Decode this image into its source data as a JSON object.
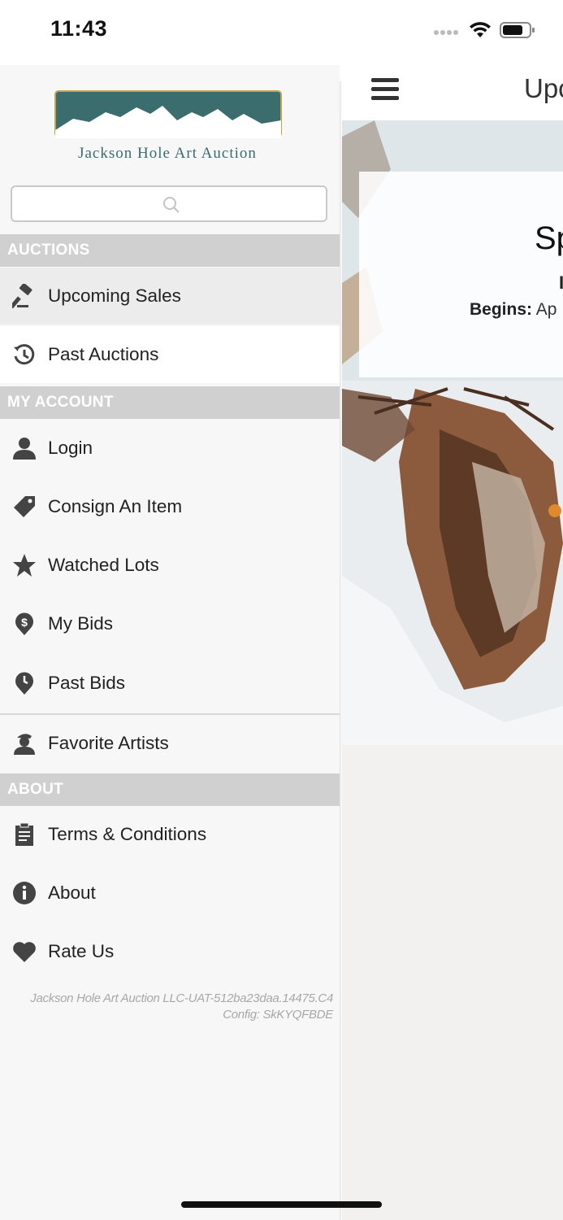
{
  "status": {
    "time": "11:43"
  },
  "brand": {
    "logo_text": "Jackson Hole Art Auction",
    "colors": {
      "teal": "#3b6c6e",
      "gold": "#c8a24e"
    }
  },
  "search": {
    "placeholder": ""
  },
  "sections": {
    "auctions": "AUCTIONS",
    "my_account": "MY ACCOUNT",
    "about": "ABOUT"
  },
  "menu": {
    "upcoming_sales": {
      "label": "Upcoming Sales",
      "icon": "gavel-icon"
    },
    "past_auctions": {
      "label": "Past Auctions",
      "icon": "history-icon"
    },
    "login": {
      "label": "Login",
      "icon": "user-icon"
    },
    "consign": {
      "label": "Consign An Item",
      "icon": "tag-icon"
    },
    "watched": {
      "label": "Watched Lots",
      "icon": "star-icon"
    },
    "my_bids": {
      "label": "My Bids",
      "icon": "dollar-pin-icon"
    },
    "past_bids": {
      "label": "Past Bids",
      "icon": "clock-pin-icon"
    },
    "favorite_artists": {
      "label": "Favorite Artists",
      "icon": "artist-icon"
    },
    "terms": {
      "label": "Terms & Conditions",
      "icon": "clipboard-icon"
    },
    "about": {
      "label": "About",
      "icon": "info-icon"
    },
    "rate_us": {
      "label": "Rate Us",
      "icon": "heart-icon"
    }
  },
  "version": {
    "line1": "Jackson Hole Art Auction LLC-UAT-512ba23daa.14475.C4",
    "line2": "Config: SkKYQFBDE"
  },
  "content": {
    "header_title": "Upc",
    "card_title": "Sp",
    "card_line2": "I",
    "card_begins_label": "Begins:",
    "card_begins_value": "Ap"
  }
}
